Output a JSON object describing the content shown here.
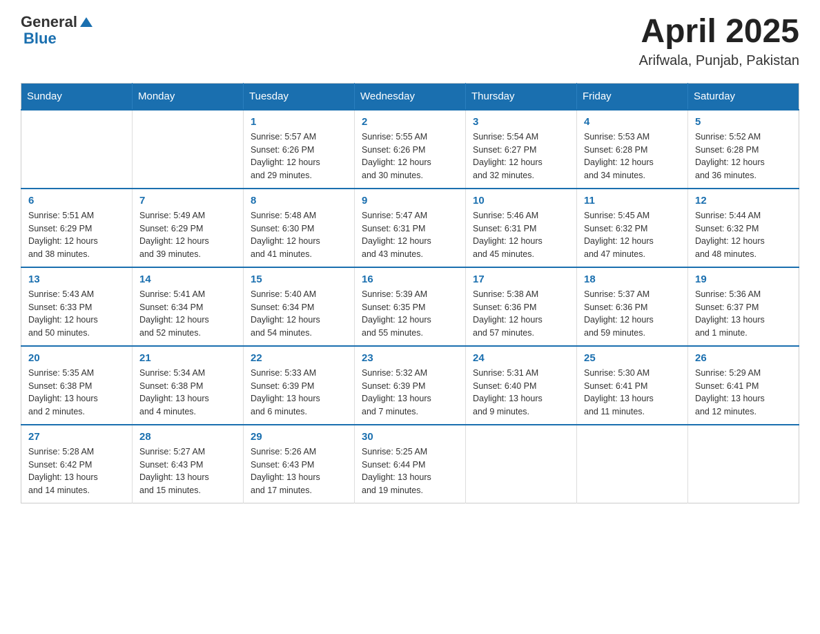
{
  "header": {
    "logo": {
      "general": "General",
      "blue": "Blue"
    },
    "title": "April 2025",
    "location": "Arifwala, Punjab, Pakistan"
  },
  "weekdays": [
    "Sunday",
    "Monday",
    "Tuesday",
    "Wednesday",
    "Thursday",
    "Friday",
    "Saturday"
  ],
  "weeks": [
    [
      {
        "day": "",
        "info": ""
      },
      {
        "day": "",
        "info": ""
      },
      {
        "day": "1",
        "info": "Sunrise: 5:57 AM\nSunset: 6:26 PM\nDaylight: 12 hours\nand 29 minutes."
      },
      {
        "day": "2",
        "info": "Sunrise: 5:55 AM\nSunset: 6:26 PM\nDaylight: 12 hours\nand 30 minutes."
      },
      {
        "day": "3",
        "info": "Sunrise: 5:54 AM\nSunset: 6:27 PM\nDaylight: 12 hours\nand 32 minutes."
      },
      {
        "day": "4",
        "info": "Sunrise: 5:53 AM\nSunset: 6:28 PM\nDaylight: 12 hours\nand 34 minutes."
      },
      {
        "day": "5",
        "info": "Sunrise: 5:52 AM\nSunset: 6:28 PM\nDaylight: 12 hours\nand 36 minutes."
      }
    ],
    [
      {
        "day": "6",
        "info": "Sunrise: 5:51 AM\nSunset: 6:29 PM\nDaylight: 12 hours\nand 38 minutes."
      },
      {
        "day": "7",
        "info": "Sunrise: 5:49 AM\nSunset: 6:29 PM\nDaylight: 12 hours\nand 39 minutes."
      },
      {
        "day": "8",
        "info": "Sunrise: 5:48 AM\nSunset: 6:30 PM\nDaylight: 12 hours\nand 41 minutes."
      },
      {
        "day": "9",
        "info": "Sunrise: 5:47 AM\nSunset: 6:31 PM\nDaylight: 12 hours\nand 43 minutes."
      },
      {
        "day": "10",
        "info": "Sunrise: 5:46 AM\nSunset: 6:31 PM\nDaylight: 12 hours\nand 45 minutes."
      },
      {
        "day": "11",
        "info": "Sunrise: 5:45 AM\nSunset: 6:32 PM\nDaylight: 12 hours\nand 47 minutes."
      },
      {
        "day": "12",
        "info": "Sunrise: 5:44 AM\nSunset: 6:32 PM\nDaylight: 12 hours\nand 48 minutes."
      }
    ],
    [
      {
        "day": "13",
        "info": "Sunrise: 5:43 AM\nSunset: 6:33 PM\nDaylight: 12 hours\nand 50 minutes."
      },
      {
        "day": "14",
        "info": "Sunrise: 5:41 AM\nSunset: 6:34 PM\nDaylight: 12 hours\nand 52 minutes."
      },
      {
        "day": "15",
        "info": "Sunrise: 5:40 AM\nSunset: 6:34 PM\nDaylight: 12 hours\nand 54 minutes."
      },
      {
        "day": "16",
        "info": "Sunrise: 5:39 AM\nSunset: 6:35 PM\nDaylight: 12 hours\nand 55 minutes."
      },
      {
        "day": "17",
        "info": "Sunrise: 5:38 AM\nSunset: 6:36 PM\nDaylight: 12 hours\nand 57 minutes."
      },
      {
        "day": "18",
        "info": "Sunrise: 5:37 AM\nSunset: 6:36 PM\nDaylight: 12 hours\nand 59 minutes."
      },
      {
        "day": "19",
        "info": "Sunrise: 5:36 AM\nSunset: 6:37 PM\nDaylight: 13 hours\nand 1 minute."
      }
    ],
    [
      {
        "day": "20",
        "info": "Sunrise: 5:35 AM\nSunset: 6:38 PM\nDaylight: 13 hours\nand 2 minutes."
      },
      {
        "day": "21",
        "info": "Sunrise: 5:34 AM\nSunset: 6:38 PM\nDaylight: 13 hours\nand 4 minutes."
      },
      {
        "day": "22",
        "info": "Sunrise: 5:33 AM\nSunset: 6:39 PM\nDaylight: 13 hours\nand 6 minutes."
      },
      {
        "day": "23",
        "info": "Sunrise: 5:32 AM\nSunset: 6:39 PM\nDaylight: 13 hours\nand 7 minutes."
      },
      {
        "day": "24",
        "info": "Sunrise: 5:31 AM\nSunset: 6:40 PM\nDaylight: 13 hours\nand 9 minutes."
      },
      {
        "day": "25",
        "info": "Sunrise: 5:30 AM\nSunset: 6:41 PM\nDaylight: 13 hours\nand 11 minutes."
      },
      {
        "day": "26",
        "info": "Sunrise: 5:29 AM\nSunset: 6:41 PM\nDaylight: 13 hours\nand 12 minutes."
      }
    ],
    [
      {
        "day": "27",
        "info": "Sunrise: 5:28 AM\nSunset: 6:42 PM\nDaylight: 13 hours\nand 14 minutes."
      },
      {
        "day": "28",
        "info": "Sunrise: 5:27 AM\nSunset: 6:43 PM\nDaylight: 13 hours\nand 15 minutes."
      },
      {
        "day": "29",
        "info": "Sunrise: 5:26 AM\nSunset: 6:43 PM\nDaylight: 13 hours\nand 17 minutes."
      },
      {
        "day": "30",
        "info": "Sunrise: 5:25 AM\nSunset: 6:44 PM\nDaylight: 13 hours\nand 19 minutes."
      },
      {
        "day": "",
        "info": ""
      },
      {
        "day": "",
        "info": ""
      },
      {
        "day": "",
        "info": ""
      }
    ]
  ]
}
